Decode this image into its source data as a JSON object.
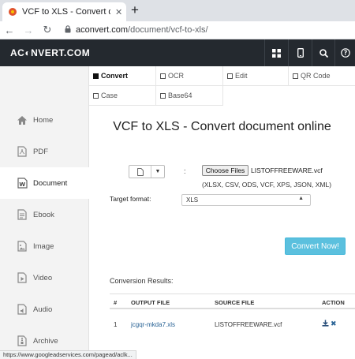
{
  "browser": {
    "tab_title": "VCF to XLS - Convert document o",
    "tab_close": "✕",
    "newtab": "+",
    "url_domain": "aconvert.com",
    "url_path": "/document/vcf-to-xls/"
  },
  "header": {
    "logo": "AC◐NVERT.COM",
    "icons": [
      "grid-icon",
      "mobile-icon",
      "search-icon",
      "help-icon"
    ]
  },
  "sidebar": {
    "items": [
      {
        "label": "Home",
        "icon": "home-icon"
      },
      {
        "label": "PDF",
        "icon": "pdf-icon"
      },
      {
        "label": "Document",
        "icon": "document-icon"
      },
      {
        "label": "Ebook",
        "icon": "ebook-icon"
      },
      {
        "label": "Image",
        "icon": "image-icon"
      },
      {
        "label": "Video",
        "icon": "video-icon"
      },
      {
        "label": "Audio",
        "icon": "audio-icon"
      },
      {
        "label": "Archive",
        "icon": "archive-icon"
      }
    ]
  },
  "subnav": {
    "items": [
      "Convert",
      "OCR",
      "Edit",
      "QR Code",
      "Case",
      "Base64"
    ]
  },
  "main": {
    "title": "VCF to XLS - Convert document online",
    "colon": ":",
    "choose_files": "Choose Files",
    "filename": "LISTOFFREEWARE.vcf",
    "formats": "(XLSX, CSV, ODS, VCF, XPS, JSON, XML)",
    "target_label": "Target format:",
    "target_value": "XLS",
    "convert_btn": "Convert Now!"
  },
  "results": {
    "label": "Conversion Results:",
    "headers": [
      "#",
      "OUTPUT FILE",
      "SOURCE FILE",
      "ACTION"
    ],
    "rows": [
      {
        "num": "1",
        "output": "jcgqr-mkda7.xls",
        "source": "LISTOFFREEWARE.vcf"
      }
    ]
  },
  "status": "https://www.googleadservices.com/pagead/aclk..."
}
